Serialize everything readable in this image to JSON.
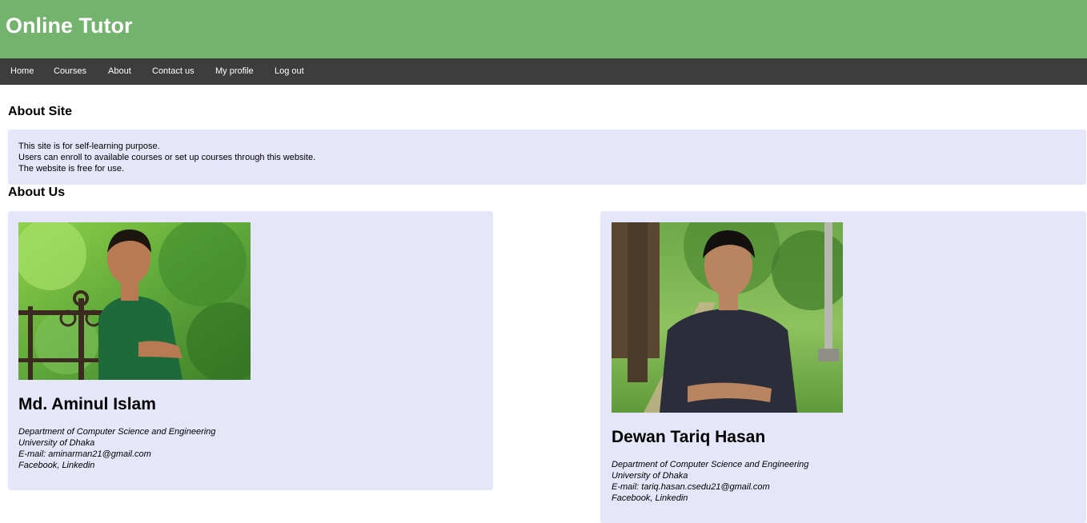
{
  "header": {
    "title": "Online Tutor"
  },
  "nav": {
    "items": [
      {
        "label": "Home"
      },
      {
        "label": "Courses"
      },
      {
        "label": "About"
      },
      {
        "label": "Contact us"
      },
      {
        "label": "My profile"
      },
      {
        "label": "Log out"
      }
    ]
  },
  "about_site": {
    "heading": "About Site",
    "lines": [
      "This site is for self-learning purpose.",
      "Users can enroll to available courses or set up courses through this website.",
      "The website is free for use."
    ]
  },
  "about_us": {
    "heading": "About Us",
    "members": [
      {
        "name": "Md. Aminul Islam",
        "department": "Department of Computer Science and Engineering",
        "university": "University of Dhaka",
        "email_line": "E-mail: aminarman21@gmail.com",
        "facebook": "Facebook",
        "separator": ", ",
        "linkedin": "Linkedin"
      },
      {
        "name": "Dewan Tariq Hasan",
        "department": "Department of Computer Science and Engineering",
        "university": "University of Dhaka",
        "email_line": "E-mail: tariq.hasan.csedu21@gmail.com",
        "facebook": "Facebook",
        "separator": ", ",
        "linkedin": "Linkedin"
      }
    ]
  },
  "colors": {
    "header_bg": "#73b36e",
    "nav_bg": "#3d3d3d",
    "panel_bg": "#e6e6fa"
  }
}
